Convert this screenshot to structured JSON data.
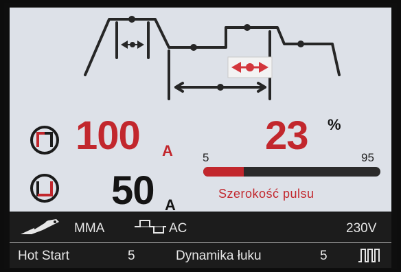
{
  "main": {
    "peak_current": "100",
    "peak_unit": "A",
    "base_current": "50",
    "base_unit": "A",
    "duty_value": "23",
    "duty_unit": "%",
    "duty_fraction": 0.23,
    "scale_min": "5",
    "scale_max": "95",
    "caption": "Szerokość pulsu"
  },
  "status": {
    "process": "MMA",
    "current_type": "AC",
    "voltage": "230V"
  },
  "params": {
    "hot_start_label": "Hot Start",
    "hot_start_value": "5",
    "arc_force_label": "Dynamika łuku",
    "arc_force_value": "5"
  },
  "icons": {
    "peak": "pulse-peak-icon",
    "base": "pulse-base-icon",
    "electrode": "electrode-holder-icon",
    "ac_wave": "ac-square-wave-icon",
    "pulse": "pulse-mode-icon"
  },
  "colors": {
    "accent": "#c2272d",
    "lcd_bg": "#dde1e8",
    "bar_dark": "#2b2b2b"
  }
}
